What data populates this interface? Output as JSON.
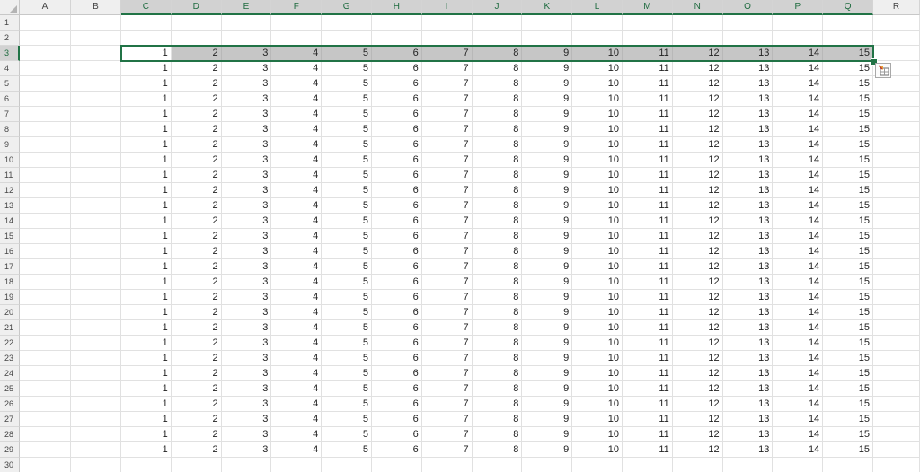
{
  "sheet": {
    "columns": [
      "A",
      "B",
      "C",
      "D",
      "E",
      "F",
      "G",
      "H",
      "I",
      "J",
      "K",
      "L",
      "M",
      "N",
      "O",
      "P",
      "Q",
      "R"
    ],
    "rows": [
      "1",
      "2",
      "3",
      "4",
      "5",
      "6",
      "7",
      "8",
      "9",
      "10",
      "11",
      "12",
      "13",
      "14",
      "15",
      "16",
      "17",
      "18",
      "19",
      "20",
      "21",
      "22",
      "23",
      "24",
      "25",
      "26",
      "27",
      "28",
      "29",
      "30"
    ],
    "data_start_row": 3,
    "data_end_row": 29,
    "data_start_col": "C",
    "values": [
      "1",
      "2",
      "3",
      "4",
      "5",
      "6",
      "7",
      "8",
      "9",
      "10",
      "11",
      "12",
      "13",
      "14",
      "15"
    ],
    "selection": "C3:Q3",
    "active_cell": "C3"
  },
  "quick_analysis": {
    "icon": "quick-analysis-icon"
  },
  "colors": {
    "accent": "#217346",
    "header_bg": "#efefef",
    "selected_fill": "#c6c6c6",
    "gridline": "#e1e1e1"
  }
}
